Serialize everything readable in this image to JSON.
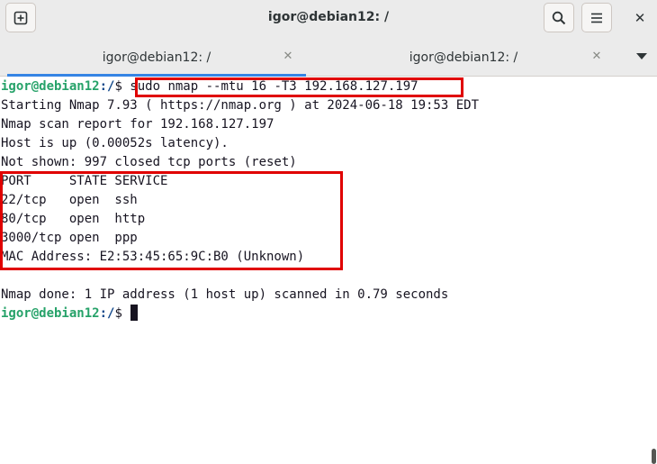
{
  "window": {
    "title": "igor@debian12: /"
  },
  "header": {
    "new_tab_icon": "new-tab-icon",
    "search_icon": "search-icon",
    "menu_icon": "hamburger-menu-icon",
    "close_label": "✕"
  },
  "tabs": [
    {
      "label": "igor@debian12: /",
      "active": true,
      "close": "✕"
    },
    {
      "label": "igor@debian12: /",
      "active": false,
      "close": "✕"
    }
  ],
  "terminal": {
    "prompt_user": "igor@debian12",
    "prompt_path": ":/",
    "prompt_symbol": "$ ",
    "command": "sudo nmap --mtu 16 -T3 192.168.127.197",
    "output": [
      "Starting Nmap 7.93 ( https://nmap.org ) at 2024-06-18 19:53 EDT",
      "Nmap scan report for 192.168.127.197",
      "Host is up (0.00052s latency).",
      "Not shown: 997 closed tcp ports (reset)",
      "PORT     STATE SERVICE",
      "22/tcp   open  ssh",
      "80/tcp   open  http",
      "3000/tcp open  ppp",
      "MAC Address: E2:53:45:65:9C:B0 (Unknown)",
      "",
      "Nmap done: 1 IP address (1 host up) scanned in 0.79 seconds"
    ],
    "prompt2_user": "igor@debian12",
    "prompt2_path": ":/",
    "prompt2_symbol": "$ "
  },
  "colors": {
    "annotation_red": "#e00000",
    "prompt_green": "#26a269",
    "prompt_blue": "#12488b",
    "active_tab_accent": "#3584e4"
  }
}
